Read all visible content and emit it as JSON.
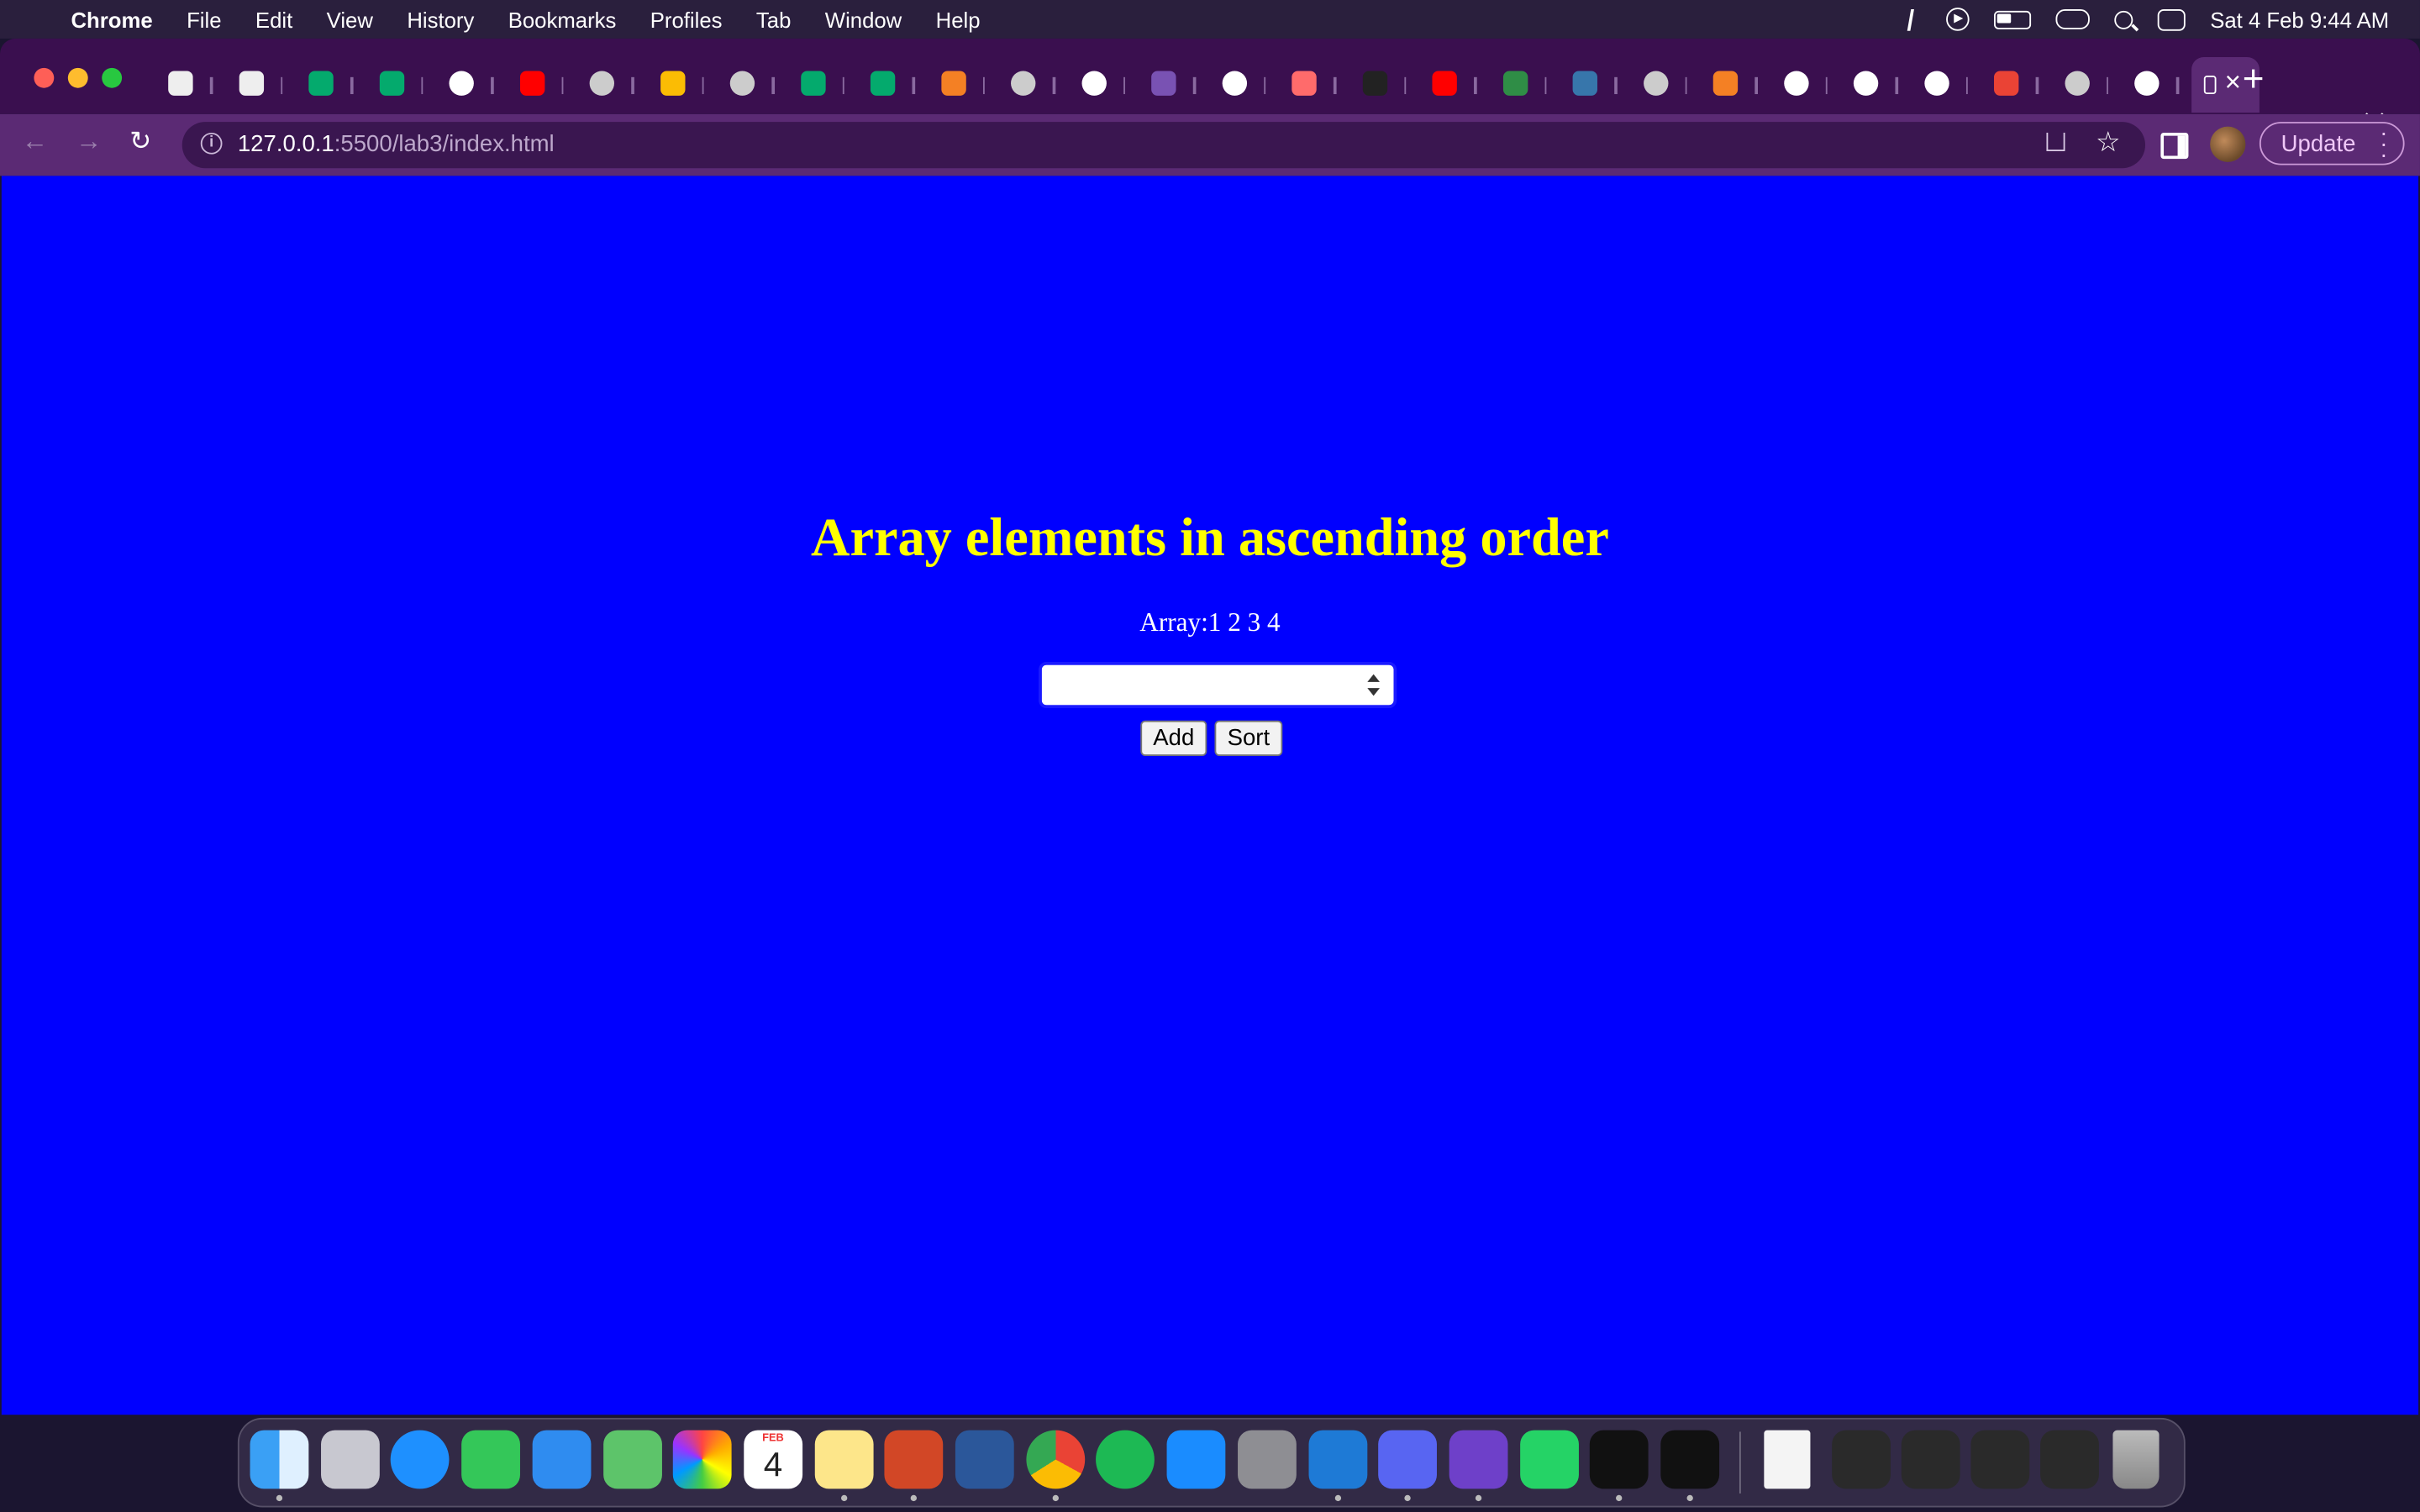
{
  "menubar": {
    "app_name": "Chrome",
    "items": [
      "File",
      "Edit",
      "View",
      "History",
      "Bookmarks",
      "Profiles",
      "Tab",
      "Window",
      "Help"
    ],
    "datetime": "Sat 4 Feb  9:44 AM"
  },
  "browser": {
    "url_host": "127.0.0.1",
    "url_path": ":5500/lab3/index.html",
    "update_label": "Update",
    "tab_favicons": [
      "codepen-icon",
      "codepen-icon",
      "w3schools-icon",
      "w3schools-icon",
      "google-icon",
      "youtube-icon",
      "globe-icon",
      "drive-icon",
      "globe-icon",
      "w3schools-icon",
      "w3schools-icon",
      "stackoverflow-icon",
      "globe-icon",
      "google-icon",
      "bootstrap-icon",
      "github-icon",
      "app-icon",
      "dark-icon",
      "youtube-icon",
      "geeksforgeeks-icon",
      "python-icon",
      "globe-icon",
      "stackoverflow-icon",
      "google-icon",
      "github-icon",
      "chrome-icon",
      "gmail-icon",
      "globe-icon",
      "google-icon"
    ]
  },
  "page": {
    "title": "Array elements in ascending order",
    "array_text": "Array:1 2 3 4",
    "input_value": "",
    "add_label": "Add",
    "sort_label": "Sort"
  },
  "calendar": {
    "month": "FEB",
    "day": "4"
  },
  "dock": {
    "apps": [
      "finder-icon",
      "launchpad-icon",
      "safari-icon",
      "messages-icon",
      "mail-icon",
      "maps-icon",
      "photos-icon",
      "calendar-icon",
      "notes-icon",
      "powerpoint-icon",
      "word-icon",
      "chrome-icon",
      "spotify-icon",
      "app-store-icon",
      "system-settings-icon",
      "vscode-icon",
      "discord-icon",
      "github-desktop-icon",
      "whatsapp-icon",
      "terminal-icon",
      "terminal-icon"
    ]
  },
  "colors": {
    "page_background": "#0000ff",
    "title_color": "#ffff00",
    "array_text_color": "#ffffff",
    "tab_strip": "#3a0f4f",
    "toolbar": "#5b2a74"
  }
}
